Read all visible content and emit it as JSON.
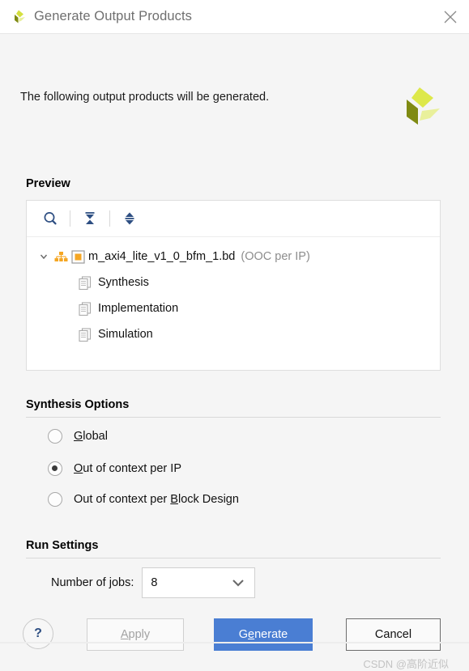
{
  "window": {
    "title": "Generate Output Products",
    "app_icon": "xilinx-logo-icon",
    "close_icon": "close-icon"
  },
  "intro": {
    "text": "The following output products will be generated."
  },
  "brand": {
    "logo_icon": "xilinx-logo-large",
    "colors": {
      "light": "#dde84a",
      "mid": "#e9f09b",
      "dark": "#7f8a12"
    }
  },
  "preview": {
    "title": "Preview",
    "toolbar": [
      {
        "name": "search-icon",
        "tooltip": "Search"
      },
      {
        "name": "collapse-all-icon",
        "tooltip": "Collapse All"
      },
      {
        "name": "expand-all-icon",
        "tooltip": "Expand All"
      }
    ],
    "tree": {
      "root": {
        "label": "m_axi4_lite_v1_0_bfm_1.bd",
        "suffix": "(OOC per IP)",
        "expanded": true,
        "hierarchy_icon": "block-design-hierarchy-icon",
        "file_icon": "block-design-file-icon"
      },
      "children": [
        {
          "label": "Synthesis",
          "icon": "document-pages-icon"
        },
        {
          "label": "Implementation",
          "icon": "document-pages-icon"
        },
        {
          "label": "Simulation",
          "icon": "document-pages-icon"
        }
      ]
    }
  },
  "synthesis_options": {
    "title": "Synthesis Options",
    "options": [
      {
        "label_pre": "",
        "mnemonic": "G",
        "label_post": "lobal",
        "selected": false
      },
      {
        "label_pre": "",
        "mnemonic": "O",
        "label_post": "ut of context per IP",
        "selected": true
      },
      {
        "label_pre": "Out of context per ",
        "mnemonic": "B",
        "label_post": "lock Design",
        "selected": false
      }
    ]
  },
  "run_settings": {
    "title": "Run Settings",
    "number_of_jobs": {
      "label": "Number of jobs:",
      "value": "8",
      "chevron_icon": "chevron-down-icon"
    }
  },
  "footer": {
    "help_label": "?",
    "apply": {
      "label": "Apply",
      "mnemonic": "A",
      "enabled": false
    },
    "generate": {
      "label_pre": "G",
      "mnemonic": "e",
      "label_post": "nerate",
      "primary": true,
      "color": "#4a7ed3"
    },
    "cancel": {
      "label": "Cancel",
      "focused": true
    }
  },
  "watermark": {
    "text": "CSDN @高阶近似"
  }
}
